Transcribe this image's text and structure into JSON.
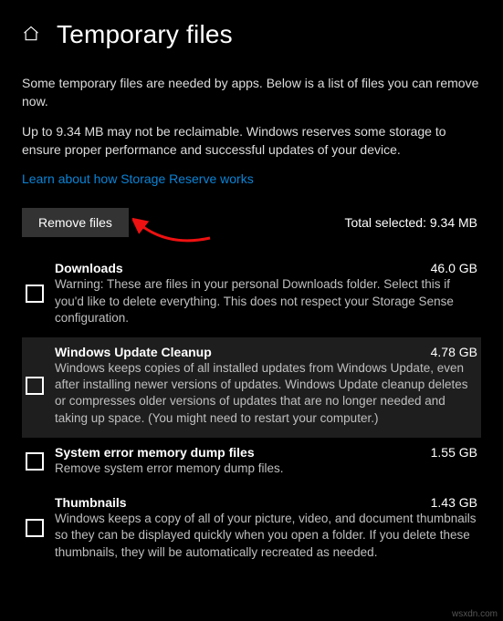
{
  "header": {
    "title": "Temporary files"
  },
  "intro": {
    "line1": "Some temporary files are needed by apps. Below is a list of files you can remove now.",
    "line2": "Up to 9.34 MB may not be reclaimable. Windows reserves some storage to ensure proper performance and successful updates of your device."
  },
  "link_text": "Learn about how Storage Reserve works",
  "remove_btn_label": "Remove files",
  "total_selected_label": "Total selected: 9.34 MB",
  "items": [
    {
      "title": "Downloads",
      "size": "46.0 GB",
      "desc": "Warning: These are files in your personal Downloads folder. Select this if you'd like to delete everything. This does not respect your Storage Sense configuration."
    },
    {
      "title": "Windows Update Cleanup",
      "size": "4.78 GB",
      "desc": "Windows keeps copies of all installed updates from Windows Update, even after installing newer versions of updates. Windows Update cleanup deletes or compresses older versions of updates that are no longer needed and taking up space. (You might need to restart your computer.)"
    },
    {
      "title": "System error memory dump files",
      "size": "1.55 GB",
      "desc": "Remove system error memory dump files."
    },
    {
      "title": "Thumbnails",
      "size": "1.43 GB",
      "desc": "Windows keeps a copy of all of your picture, video, and document thumbnails so they can be displayed quickly when you open a folder. If you delete these thumbnails, they will be automatically recreated as needed."
    }
  ],
  "footnote": "wsxdn.com"
}
